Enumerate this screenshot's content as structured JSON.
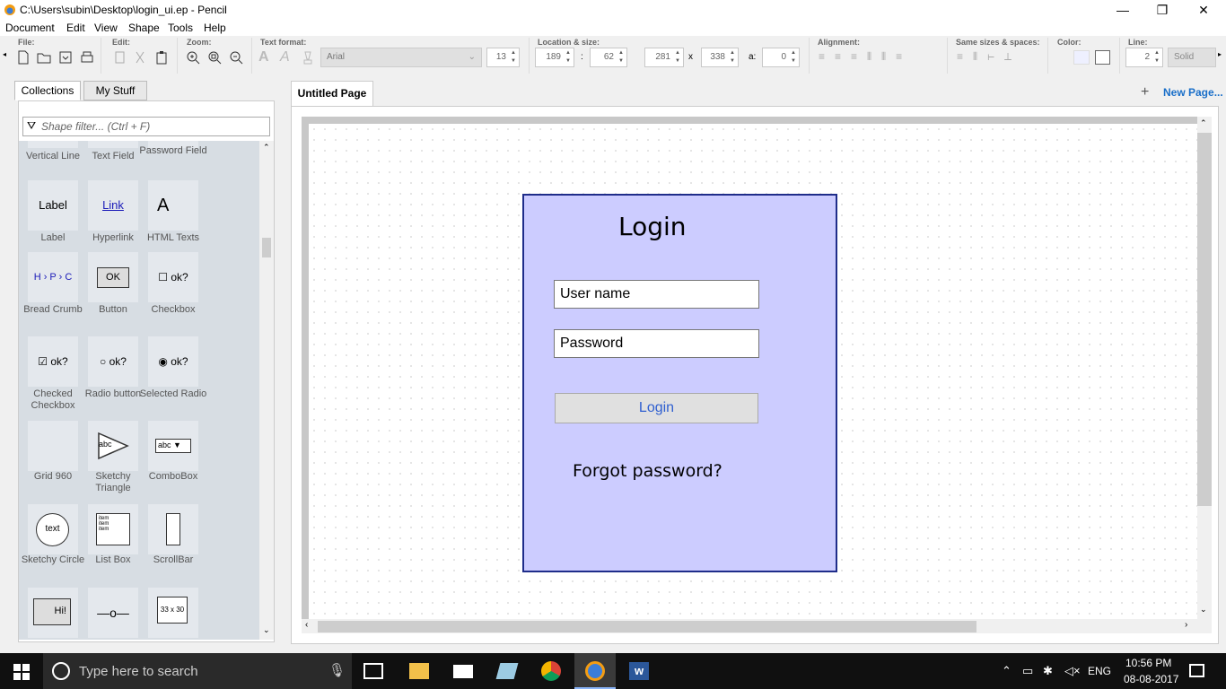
{
  "window": {
    "title": "C:\\Users\\subin\\Desktop\\login_ui.ep - Pencil",
    "minimize": "—",
    "restore": "❐",
    "close": "✕"
  },
  "menu": [
    "Document",
    "Edit",
    "View",
    "Shape",
    "Tools",
    "Help"
  ],
  "toolbar": {
    "groups": {
      "file": "File:",
      "edit": "Edit:",
      "zoom": "Zoom:",
      "text_format": "Text format:",
      "location_size": "Location & size:",
      "alignment": "Alignment:",
      "same_sizes": "Same sizes & spaces:",
      "color": "Color:",
      "line": "Line:"
    },
    "font_family": "Arial",
    "font_size": "13",
    "loc_x": "189",
    "loc_sep": ":",
    "loc_y": "62",
    "width": "281",
    "size_sep": "x",
    "height": "338",
    "angle_label": "a:",
    "angle": "0",
    "line_width": "2",
    "line_style": "Solid"
  },
  "left_panel": {
    "tabs": [
      "Collections",
      "My Stuff"
    ],
    "filter_placeholder": "Shape filter... (Ctrl + F)",
    "shapes": [
      {
        "label": "Vertical Line",
        "glyph": ""
      },
      {
        "label": "Text Field",
        "glyph": ""
      },
      {
        "label": "Password Field",
        "glyph": ""
      },
      {
        "label": "Label",
        "glyph": "Label"
      },
      {
        "label": "Hyperlink",
        "glyph": "Link"
      },
      {
        "label": "HTML Texts",
        "glyph": "A"
      },
      {
        "label": "Bread Crumb",
        "glyph": "H › P › C"
      },
      {
        "label": "Button",
        "glyph": "OK"
      },
      {
        "label": "Checkbox",
        "glyph": "☐ ok?"
      },
      {
        "label": "Checked Checkbox",
        "glyph": "☑ ok?"
      },
      {
        "label": "Radio button",
        "glyph": "○ ok?"
      },
      {
        "label": "Selected Radio",
        "glyph": "◉ ok?"
      },
      {
        "label": "Grid 960",
        "glyph": ""
      },
      {
        "label": "Sketchy Triangle",
        "glyph": "abc"
      },
      {
        "label": "ComboBox",
        "glyph": "abc ▼"
      },
      {
        "label": "Sketchy Circle",
        "glyph": "text"
      },
      {
        "label": "List Box",
        "glyph": "item"
      },
      {
        "label": "ScrollBar",
        "glyph": ""
      },
      {
        "label": "",
        "glyph": "Hi!"
      },
      {
        "label": "",
        "glyph": "—o—"
      },
      {
        "label": "",
        "glyph": "33 x 30"
      }
    ]
  },
  "page_tab": "Untitled Page",
  "new_page": "New Page...",
  "mockup": {
    "title": "Login",
    "username": "User name",
    "password": "Password",
    "button": "Login",
    "forgot": "Forgot password?",
    "box_color": "#ccccff",
    "border_color": "#1f2d8a"
  },
  "taskbar": {
    "search_placeholder": "Type here to search",
    "lang": "ENG",
    "time": "10:56 PM",
    "date": "08-08-2017"
  }
}
